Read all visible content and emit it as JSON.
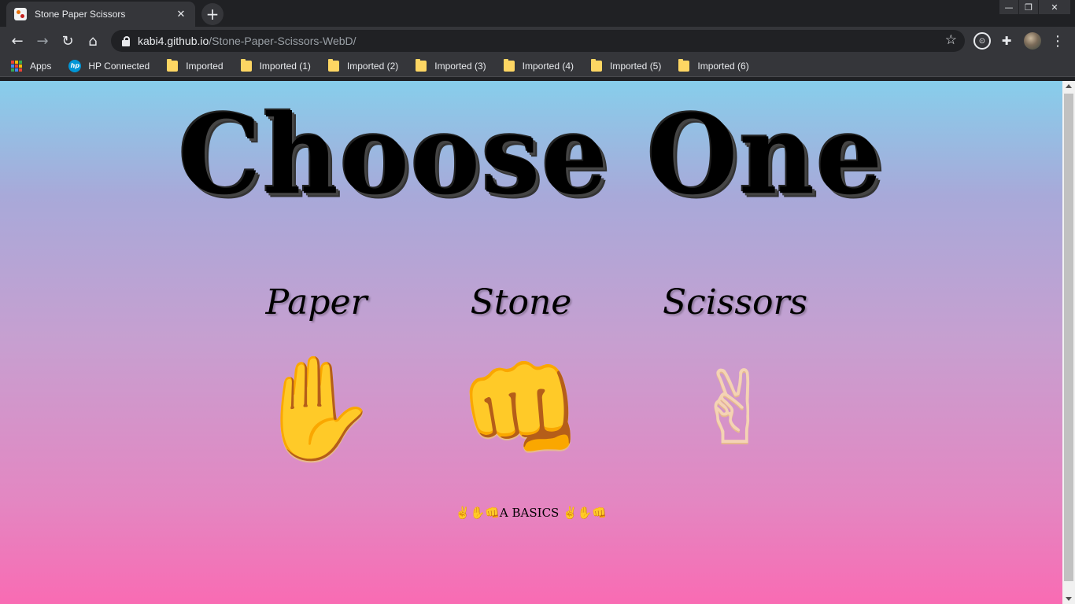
{
  "browser": {
    "tab": {
      "title": "Stone Paper Scissors",
      "favicon": "site-favicon",
      "close_glyph": "✕"
    },
    "new_tab_glyph": "+",
    "window_controls": {
      "minimize": "—",
      "restore": "❐",
      "close": "✕"
    },
    "toolbar": {
      "back": "←",
      "forward": "→",
      "reload": "↻",
      "home": "⌂",
      "url_host": "kabi4.github.io",
      "url_path": "/Stone-Paper-Scissors-WebD/",
      "bookmark_star": "☆",
      "extension_icon": "⊙",
      "extensions_puzzle": "✚",
      "menu": "⋮"
    },
    "bookmarks": [
      {
        "label": "Apps",
        "icon": "apps-grid-icon"
      },
      {
        "label": "HP Connected",
        "icon": "hp-icon"
      },
      {
        "label": "Imported",
        "icon": "folder-icon"
      },
      {
        "label": "Imported (1)",
        "icon": "folder-icon"
      },
      {
        "label": "Imported (2)",
        "icon": "folder-icon"
      },
      {
        "label": "Imported (3)",
        "icon": "folder-icon"
      },
      {
        "label": "Imported (4)",
        "icon": "folder-icon"
      },
      {
        "label": "Imported (5)",
        "icon": "folder-icon"
      },
      {
        "label": "Imported (6)",
        "icon": "folder-icon"
      }
    ],
    "hp_icon_text": "hp"
  },
  "page": {
    "title": "Choose One",
    "choices": [
      {
        "label": "Paper",
        "emoji": "✋"
      },
      {
        "label": "Stone",
        "emoji": "👊"
      },
      {
        "label": "Scissors",
        "emoji": "✌"
      }
    ],
    "footer": "✌✋👊A BASICS ✌✋👊"
  },
  "colors": {
    "gradient_top": "#87ceeb",
    "gradient_bottom": "#f96bb3",
    "browser_dark": "#202124",
    "toolbar": "#35363a"
  }
}
